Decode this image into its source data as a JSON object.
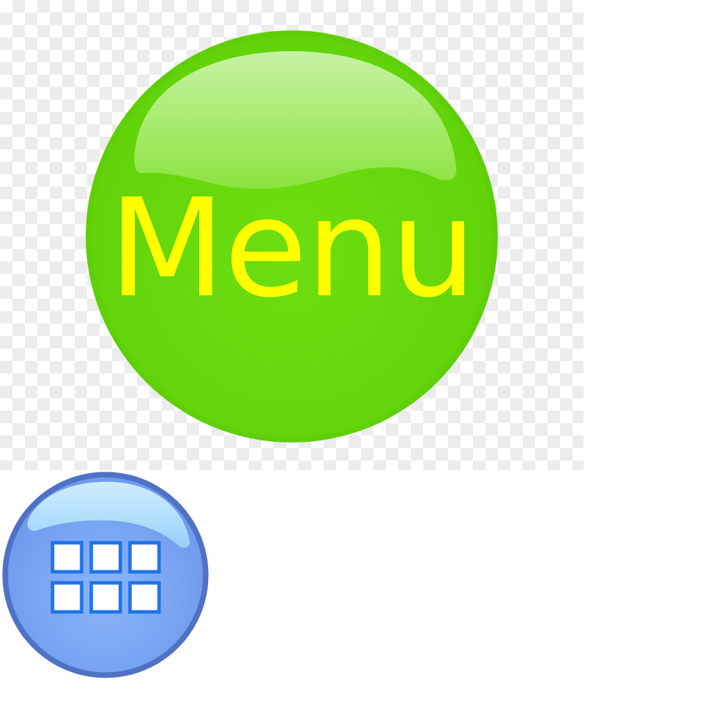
{
  "menu_button": {
    "label": "Menu",
    "icon": "glossy-round-button",
    "colors": {
      "fill": "#6cdc0e",
      "rim": "#5fcf08",
      "highlight": "#c7f3a4",
      "label": "#ffff00"
    }
  },
  "grid_button": {
    "icon": "app-grid-icon",
    "cells": 6,
    "colors": {
      "fill": "#7fa9f5",
      "rim": "#4f72c4",
      "highlight": "#c8ecff",
      "cell_border": "#1e73e8",
      "cell_fill": "#ffffff"
    }
  },
  "background": {
    "pattern": "transparency-checkerboard",
    "colors": [
      "#ffffff",
      "#ececec"
    ]
  }
}
